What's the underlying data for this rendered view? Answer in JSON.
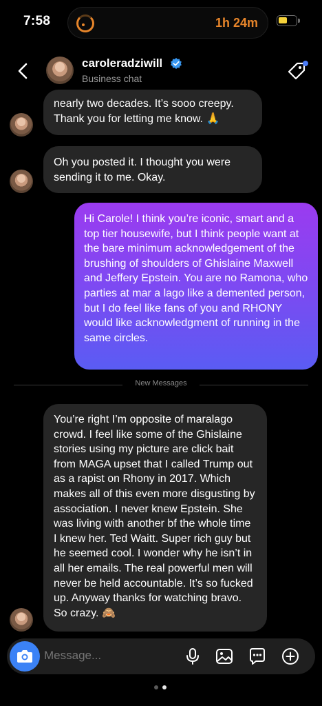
{
  "status_bar": {
    "time": "7:58",
    "activity_timer": "1h 24m",
    "accent": "#e7852a"
  },
  "header": {
    "contact_name": "caroleradziwill",
    "subtitle": "Business chat",
    "verified_color": "#3897f0"
  },
  "messages": [
    {
      "direction": "in",
      "text": "nearly two decades. It’s sooo creepy. Thank you for letting me know. 🙏"
    },
    {
      "direction": "in",
      "text": "Oh you posted it. I thought you were sending it to me. Okay."
    },
    {
      "direction": "out",
      "text": "Hi Carole! I think you’re iconic,  smart and a top tier housewife, but I think people want at the bare minimum acknowledgement of the brushing of shoulders of Ghislaine Maxwell and Jeffery Epstein. You are no Ramona, who parties at mar a lago like a demented person, but I do feel like fans of you and RHONY would like acknowledgment of running in the same circles."
    },
    {
      "direction": "in",
      "text": "You’re right I’m opposite of maralago crowd. I feel like some of the Ghislaine stories using my picture are click bait from MAGA upset that I called Trump out as a rapist on Rhony in 2017. Which makes all of this even more disgusting by association. I never knew Epstein. She was living with another bf the whole time I knew her. Ted Waitt. Super rich guy but he seemed cool. I wonder why he isn’t in all her emails. The real powerful men will never be held accountable. It’s so fucked up. Anyway thanks for watching bravo.  So crazy. 🙈"
    }
  ],
  "divider_label": "New Messages",
  "composer": {
    "placeholder": "Message..."
  },
  "colors": {
    "incoming_bubble": "#262626",
    "outgoing_gradient_top": "#9b3bf0",
    "outgoing_gradient_bottom": "#5a5cf3",
    "camera_button": "#3b82f6",
    "notification_dot": "#4a7bf7"
  },
  "icons": [
    "back-arrow-icon",
    "verified-badge-icon",
    "tag-icon",
    "camera-icon",
    "microphone-icon",
    "gallery-icon",
    "sticker-icon",
    "plus-icon"
  ],
  "page_indicator": {
    "count": 2,
    "active_index": 1
  }
}
